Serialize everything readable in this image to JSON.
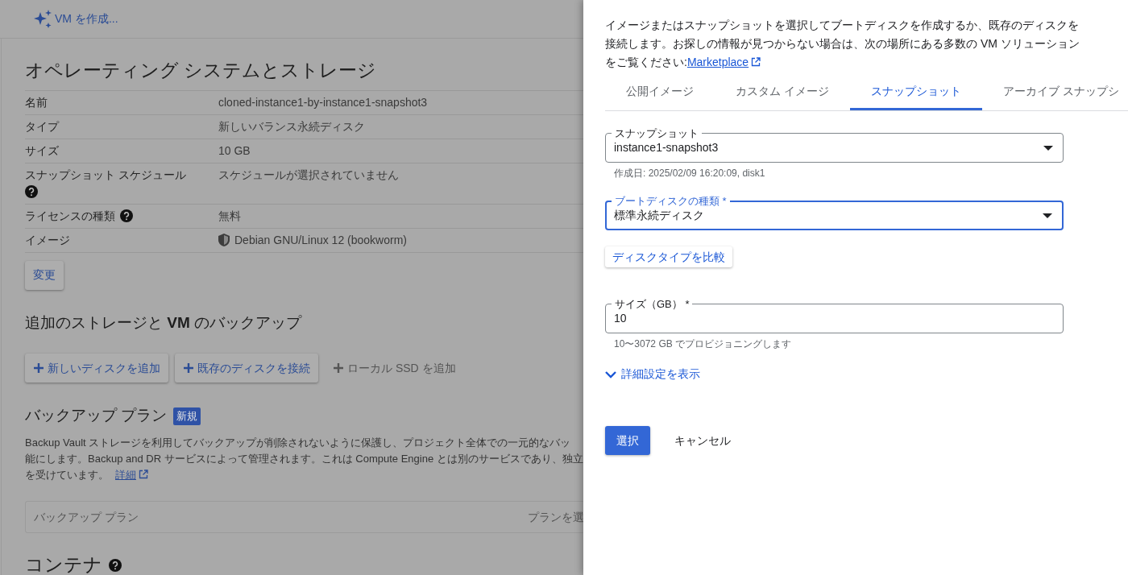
{
  "background_page": {
    "create_vm_button": "VM を作成...",
    "os_storage": {
      "title": "オペレーティング システムとストレージ",
      "rows": [
        {
          "label": "名前",
          "value": "cloned-instance1-by-instance1-snapshot3",
          "help": false,
          "shield": false
        },
        {
          "label": "タイプ",
          "value": "新しいバランス永続ディスク",
          "help": false,
          "shield": false
        },
        {
          "label": "サイズ",
          "value": "10 GB",
          "help": false,
          "shield": false
        },
        {
          "label": "スナップショット スケジュール",
          "value": "スケジュールが選択されていません",
          "help": true,
          "shield": false
        },
        {
          "label": "ライセンスの種類",
          "value": "無料",
          "help": true,
          "shield": false
        },
        {
          "label": "イメージ",
          "value": "Debian GNU/Linux 12 (bookworm)",
          "help": false,
          "shield": true
        }
      ],
      "change_button": "変更"
    },
    "additional_storage": {
      "title": "追加のストレージと **VM** のバックアップ",
      "buttons": [
        {
          "label": "新しいディスクを追加",
          "disabled": false
        },
        {
          "label": "既存のディスクを接続",
          "disabled": false
        },
        {
          "label": "ローカル SSD を追加",
          "disabled": true
        }
      ]
    },
    "backup_plan": {
      "title": "バックアップ プラン",
      "badge": "新規",
      "description_lines": [
        "Backup Vault ストレージを利用してバックアップが削除されないように保護し、プロジェクト全体での一元的なバッ",
        "能にします。Backup and DR サービスによって管理されます。これは Compute Engine とは別のサービスであり、独立",
        "を受けています。"
      ],
      "link": "詳細",
      "field": {
        "label": "バックアップ プラン",
        "action": "プランを選"
      }
    },
    "containers": {
      "title": "コンテナ",
      "help": true
    }
  },
  "drawer": {
    "description": "イメージまたはスナップショットを選択してブートディスクを作成するか、既存のディスクを接続します。お探しの情報が見つからない場合は、次の場所にある多数の VM ソリューションをご覧ください:",
    "link": "Marketplace",
    "tabs": [
      {
        "label": "公開イメージ",
        "selected": false
      },
      {
        "label": "カスタム イメージ",
        "selected": false
      },
      {
        "label": "スナップショット",
        "selected": true
      },
      {
        "label": "アーカイブ スナップシ",
        "selected": false
      }
    ],
    "fields": [
      {
        "kind": "select",
        "label": "スナップショット",
        "value": "instance1-snapshot3",
        "hint": "作成日: 2025/02/09 16:20:09, disk1",
        "focused": false
      },
      {
        "kind": "select",
        "label": "ブートディスクの種類 *",
        "value": "標準永続ディスク",
        "focused": true
      },
      {
        "kind": "button",
        "label": "ディスクタイプを比較"
      },
      {
        "kind": "input",
        "label": "サイズ（GB） *",
        "value": "10",
        "hint": "10〜3072 GB でプロビジョニングします",
        "focused": false
      }
    ],
    "advanced_toggle": {
      "label": "詳細設定を表示",
      "expanded": false
    },
    "buttons": [
      {
        "label": "選択",
        "primary": true
      },
      {
        "label": "キャンセル",
        "primary": false
      }
    ]
  }
}
